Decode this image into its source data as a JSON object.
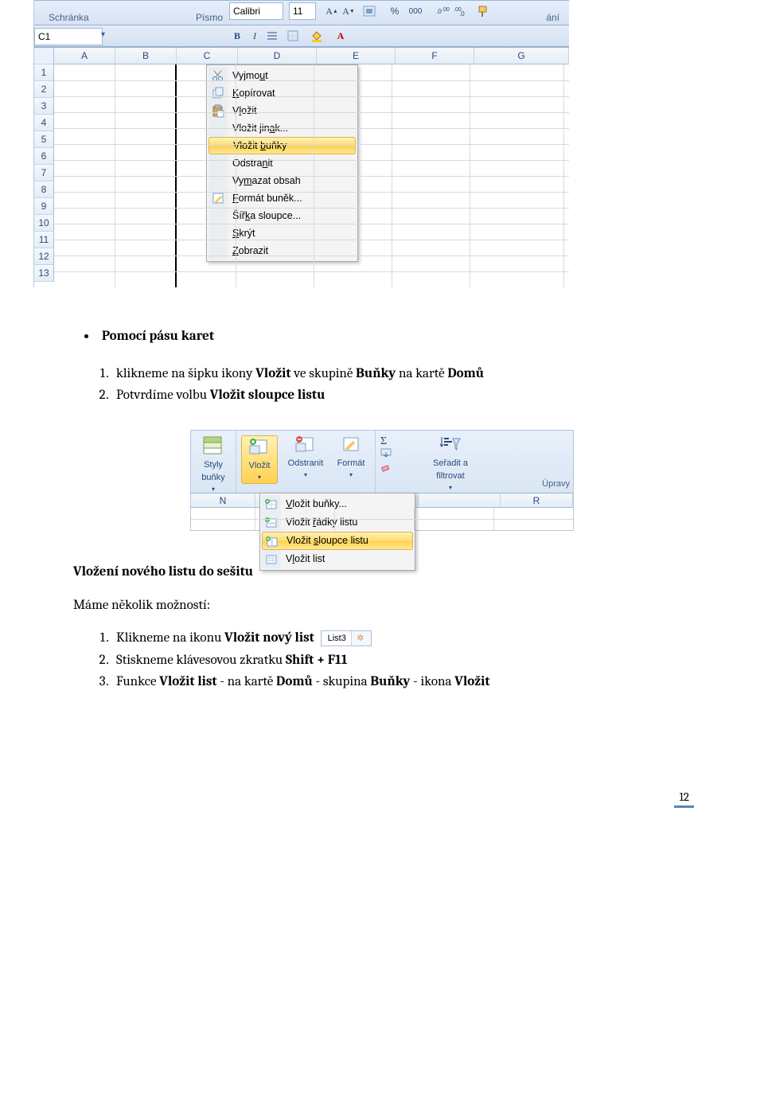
{
  "screenshot1": {
    "ribbon_group_left": "Schránka",
    "ribbon_group_center": "Písmo",
    "ribbon_group_right_fragment": "ání",
    "font_name": "Calibri",
    "font_size": "11",
    "namebox_value": "C1",
    "percent_glyph": "%",
    "zeroes_glyph": "000",
    "columns": [
      "A",
      "B",
      "C",
      "D",
      "E",
      "F",
      "G"
    ],
    "rows": [
      "1",
      "2",
      "3",
      "4",
      "5",
      "6",
      "7",
      "8",
      "9",
      "10",
      "11",
      "12",
      "13"
    ],
    "context_menu": {
      "items": [
        {
          "icon": "cut",
          "label_pre": "Vyjmo",
          "label_u": "u",
          "label_post": "t"
        },
        {
          "icon": "copy",
          "label_pre": "",
          "label_u": "K",
          "label_post": "opírovat"
        },
        {
          "icon": "paste",
          "label_pre": "V",
          "label_u": "l",
          "label_post": "ožit"
        },
        {
          "icon": "",
          "label_pre": "Vložit jin",
          "label_u": "a",
          "label_post": "k..."
        },
        {
          "icon": "",
          "label_pre": "Vložit ",
          "label_u": "b",
          "label_post": "uňky",
          "highlight": true
        },
        {
          "icon": "",
          "label_pre": "Odstra",
          "label_u": "n",
          "label_post": "it"
        },
        {
          "icon": "",
          "label_pre": "Vy",
          "label_u": "m",
          "label_post": "azat obsah"
        },
        {
          "icon": "format",
          "label_pre": "",
          "label_u": "F",
          "label_post": "ormát buněk..."
        },
        {
          "icon": "",
          "label_pre": "Šíř",
          "label_u": "k",
          "label_post": "a sloupce..."
        },
        {
          "icon": "",
          "label_pre": "",
          "label_u": "S",
          "label_post": "krýt"
        },
        {
          "icon": "",
          "label_pre": "",
          "label_u": "Z",
          "label_post": "obrazit"
        }
      ]
    }
  },
  "text1": {
    "heading": "Pomocí pásu karet",
    "step1_pre": "klikneme na šipku ikony ",
    "step1_b1": "Vložit",
    "step1_mid": " ve skupině ",
    "step1_b2": "Buňky",
    "step1_mid2": " na kartě ",
    "step1_b3": "Domů",
    "step2_pre": "Potvrdíme volbu ",
    "step2_b": "Vložit sloupce listu"
  },
  "screenshot2": {
    "groups": {
      "styly": "Styly\nbuňky",
      "vlozit": "Vložit",
      "odstranit": "Odstranit",
      "format": "Formát",
      "seradit": "Seřadit a\nfiltrovat",
      "upravy_label": "Úpravy"
    },
    "sigma": "Σ",
    "cols": [
      "N",
      "",
      "",
      "",
      "R"
    ],
    "dropdown": {
      "items": [
        {
          "label_pre": "",
          "label_u": "V",
          "label_post": "ložit buňky..."
        },
        {
          "label_pre": "Vložit ",
          "label_u": "ř",
          "label_post": "ádky listu"
        },
        {
          "label_pre": "Vložit ",
          "label_u": "s",
          "label_post": "loupce listu",
          "highlight": true
        },
        {
          "label_pre": "V",
          "label_u": "l",
          "label_post": "ožit list"
        }
      ]
    }
  },
  "text2": {
    "heading": "Vložení nového listu do sešitu",
    "intro": "Máme několik možností:",
    "step1_pre": "Klikneme na ikonu ",
    "step1_b": "Vložit nový list",
    "sheettab_label": "List3",
    "step2_pre": "Stiskneme klávesovou zkratku ",
    "step2_b": "Shift + F11",
    "step3_pre": "Funkce ",
    "step3_b1": "Vložit list",
    "step3_mid1": " - na kartě ",
    "step3_b2": "Domů",
    "step3_mid2": " - skupina ",
    "step3_b3": "Buňky",
    "step3_mid3": " - ikona ",
    "step3_b4": "Vložit"
  },
  "page_number": "12"
}
